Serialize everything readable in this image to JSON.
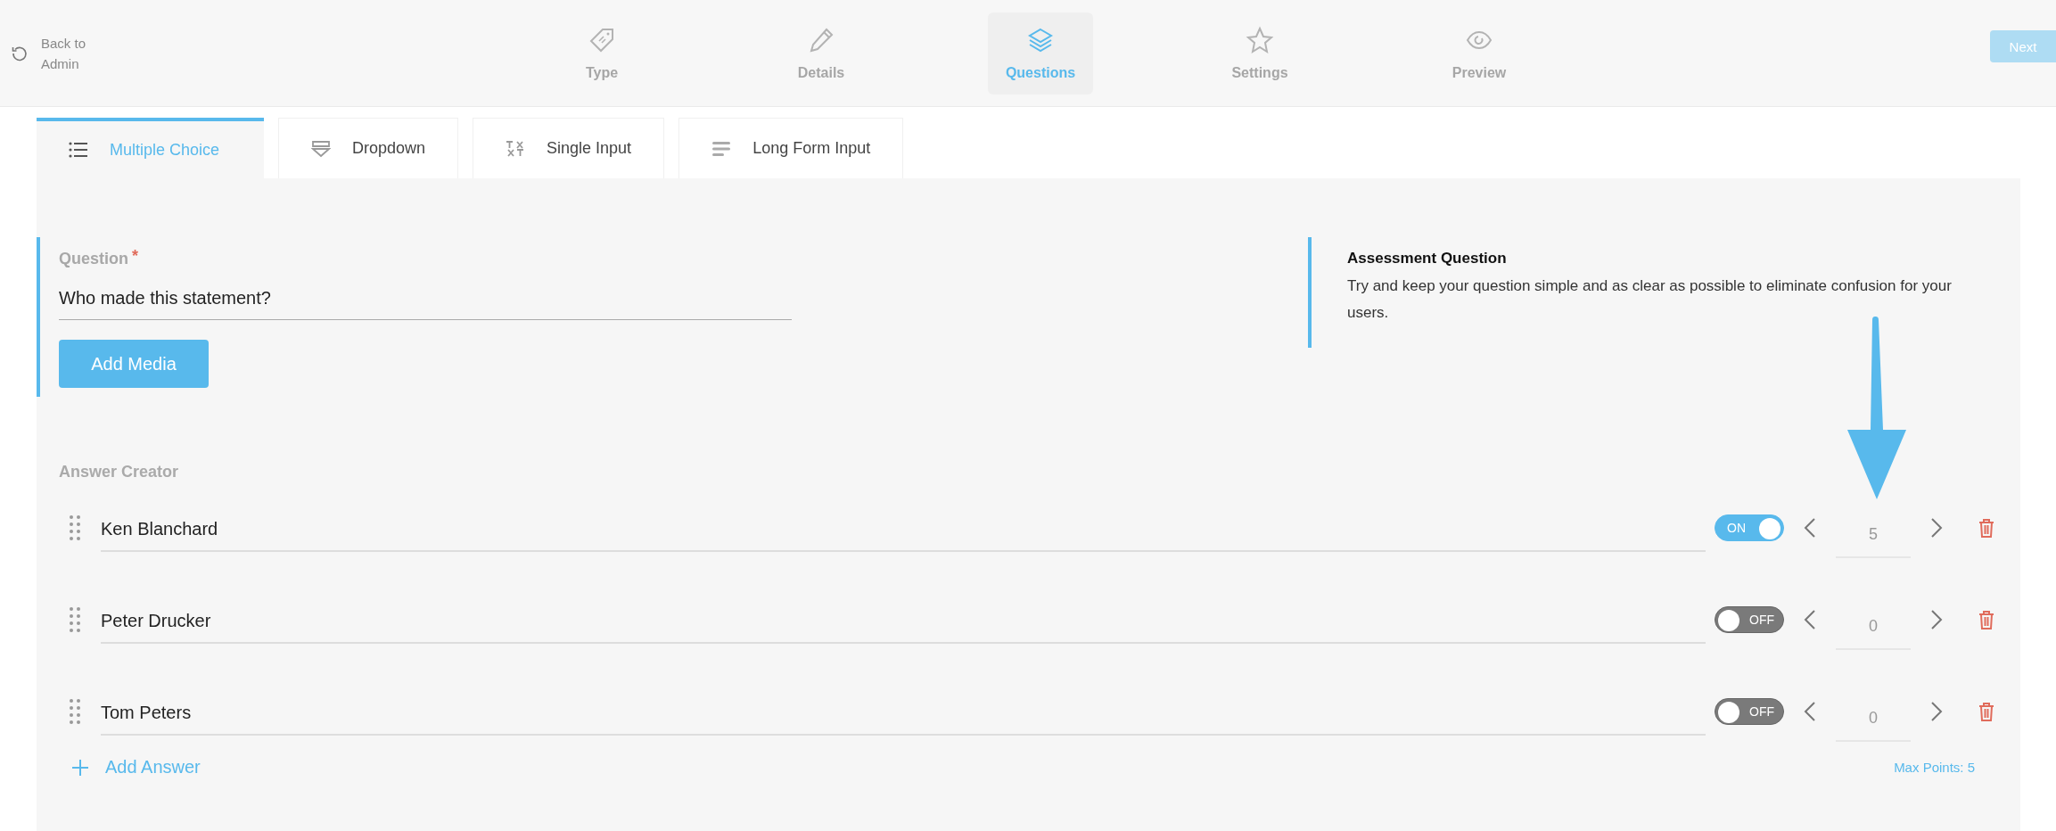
{
  "back_link": {
    "label": "Back to Admin"
  },
  "steps": [
    {
      "label": "Type",
      "kind": "tag",
      "selected": false
    },
    {
      "label": "Details",
      "kind": "pencil",
      "selected": false
    },
    {
      "label": "Questions",
      "kind": "layers",
      "selected": true
    },
    {
      "label": "Settings",
      "kind": "star",
      "selected": false
    },
    {
      "label": "Preview",
      "kind": "eye",
      "selected": false
    }
  ],
  "next_button": {
    "label": "Next",
    "disabled": true
  },
  "question_types": [
    {
      "label": "Multiple Choice",
      "kind": "list",
      "selected": true
    },
    {
      "label": "Dropdown",
      "kind": "dropdown",
      "selected": false
    },
    {
      "label": "Single Input",
      "kind": "text",
      "selected": false
    },
    {
      "label": "Long Form Input",
      "kind": "lines",
      "selected": false
    }
  ],
  "question": {
    "label": "Question",
    "required": true,
    "required_mark": "*",
    "value": "Who made this statement?",
    "add_media": "Add Media"
  },
  "hint": {
    "title": "Assessment Question",
    "text": "Try and keep your question simple and as clear as possible to eliminate confusion for your users."
  },
  "answer_creator": {
    "label": "Answer Creator",
    "answers": [
      {
        "text": "Ken Blanchard",
        "on": true,
        "toggle_label": "ON",
        "points": "5"
      },
      {
        "text": "Peter Drucker",
        "on": false,
        "toggle_label": "OFF",
        "points": "0"
      },
      {
        "text": "Tom Peters",
        "on": false,
        "toggle_label": "OFF",
        "points": "0"
      }
    ],
    "add_answer": "Add Answer",
    "max_points": "Max Points: 5"
  }
}
